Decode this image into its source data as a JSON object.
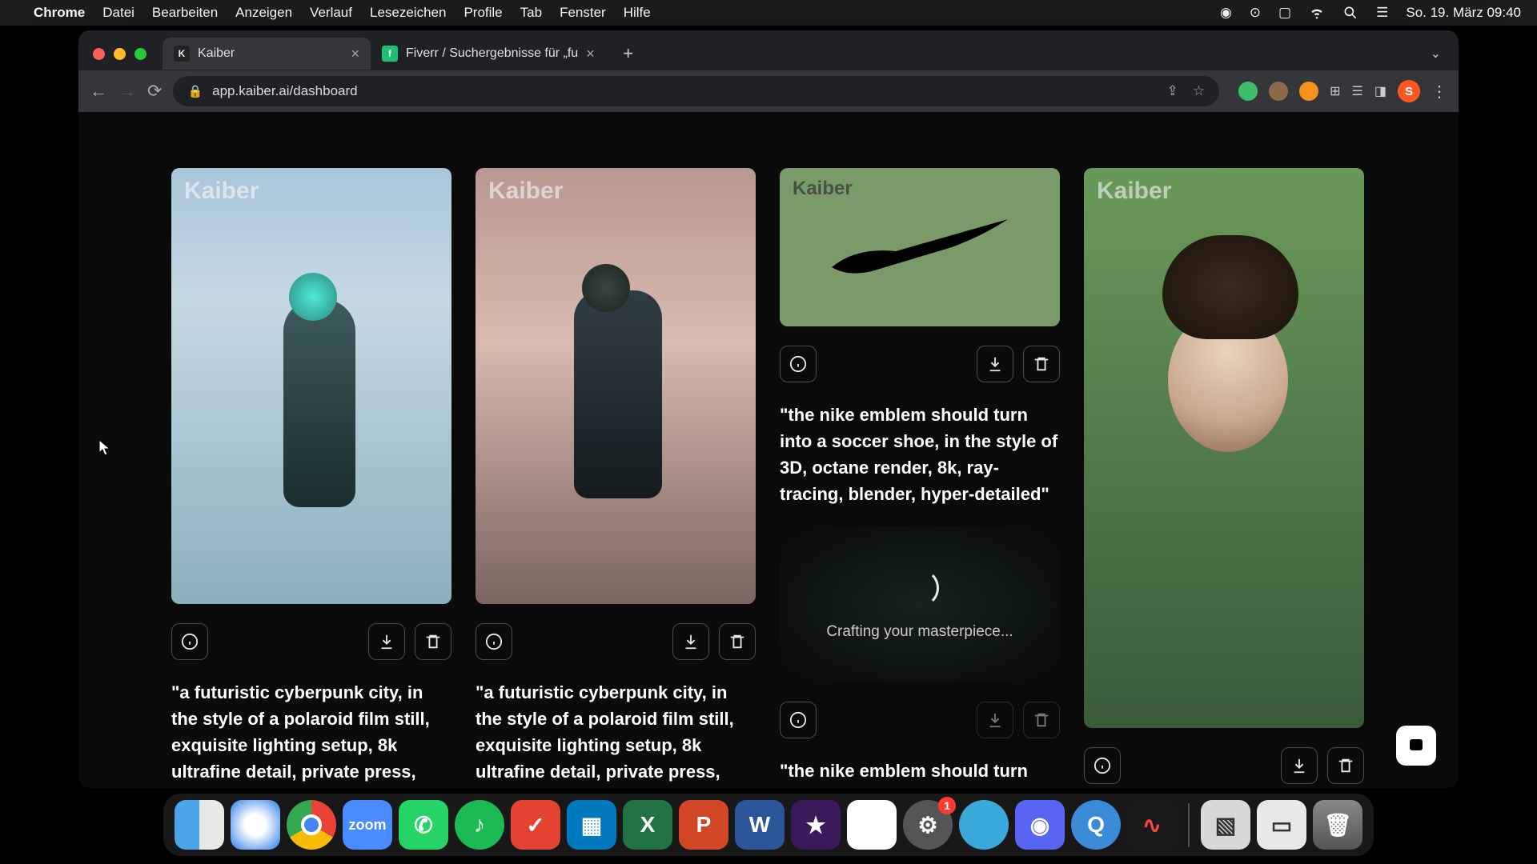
{
  "menubar": {
    "app": "Chrome",
    "items": [
      "Datei",
      "Bearbeiten",
      "Anzeigen",
      "Verlauf",
      "Lesezeichen",
      "Profile",
      "Tab",
      "Fenster",
      "Hilfe"
    ],
    "clock": "So. 19. März 09:40"
  },
  "tabs": [
    {
      "title": "Kaiber",
      "favicon": "K",
      "active": true
    },
    {
      "title": "Fiverr / Suchergebnisse für „fu",
      "favicon": "f",
      "active": false
    }
  ],
  "url": "app.kaiber.ai/dashboard",
  "profile_initial": "S",
  "watermark": "Kaiber",
  "cards": [
    {
      "prompt": "\"a futuristic cyberpunk city, in the style of a polaroid film still, exquisite lighting setup, 8k ultrafine detail, private press,"
    },
    {
      "prompt": "\"a futuristic cyberpunk city, in the style of a polaroid film still, exquisite lighting setup, 8k ultrafine detail, private press,"
    },
    {
      "prompt": "\"the nike emblem should turn into a soccer shoe, in the style of 3D, octane render, 8k, ray-tracing, blender, hyper-detailed\""
    },
    {
      "prompt": "\"the nike emblem should turn into"
    }
  ],
  "loading_text": "Crafting your masterpiece...",
  "dock": {
    "badge_settings": "1"
  }
}
